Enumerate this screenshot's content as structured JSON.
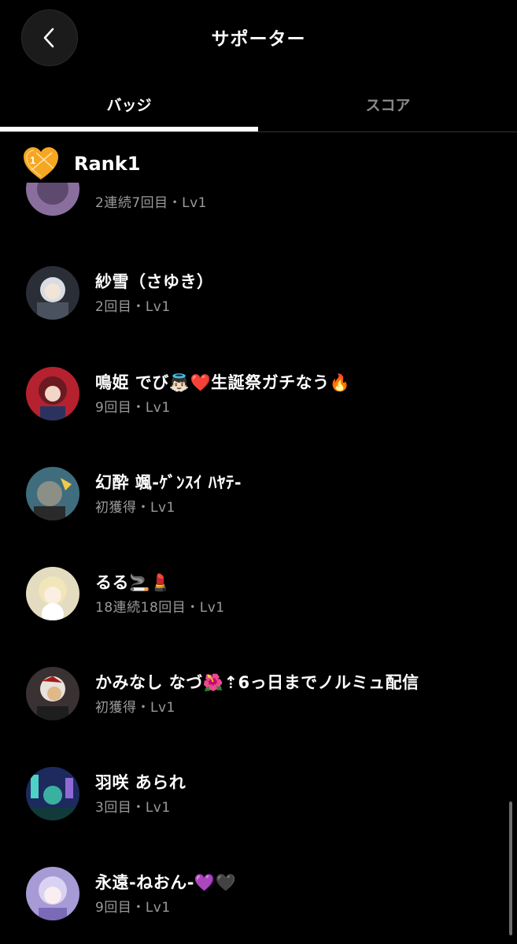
{
  "header": {
    "title": "サポーター",
    "back_icon": "chevron-left-icon"
  },
  "tabs": [
    {
      "label": "バッジ",
      "active": true
    },
    {
      "label": "スコア",
      "active": false
    }
  ],
  "rank": {
    "label": "Rank1",
    "icon": "heart-badge-icon",
    "accent": "#f5a623"
  },
  "supporters": [
    {
      "name": "",
      "sub": "2連続7回目・Lv1",
      "avatar_color": "#8a6f9e"
    },
    {
      "name": "紗雪（さゆき）",
      "sub": "2回目・Lv1",
      "avatar_color": "#6d7f8f"
    },
    {
      "name": "鳴姫 でび👼🏻❤️生誕祭ガチなう🔥",
      "sub": "9回目・Lv1",
      "avatar_color": "#b5212f"
    },
    {
      "name": "幻酔 颯-ｹﾞﾝｽｲ ﾊﾔﾃ-",
      "sub": "初獲得・Lv1",
      "avatar_color": "#3f6d7e"
    },
    {
      "name": "るる🚬💄",
      "sub": "18連続18回目・Lv1",
      "avatar_color": "#e3dcc0"
    },
    {
      "name": "かみなし なづ🌺⇡6っ日までノルミュ配信",
      "sub": "初獲得・Lv1",
      "avatar_color": "#5a4a4a"
    },
    {
      "name": "羽咲 あられ",
      "sub": "3回目・Lv1",
      "avatar_color": "#2b3f7a"
    },
    {
      "name": "永遠-ねおん-💜🖤",
      "sub": "9回目・Lv1",
      "avatar_color": "#a79bd6"
    }
  ]
}
